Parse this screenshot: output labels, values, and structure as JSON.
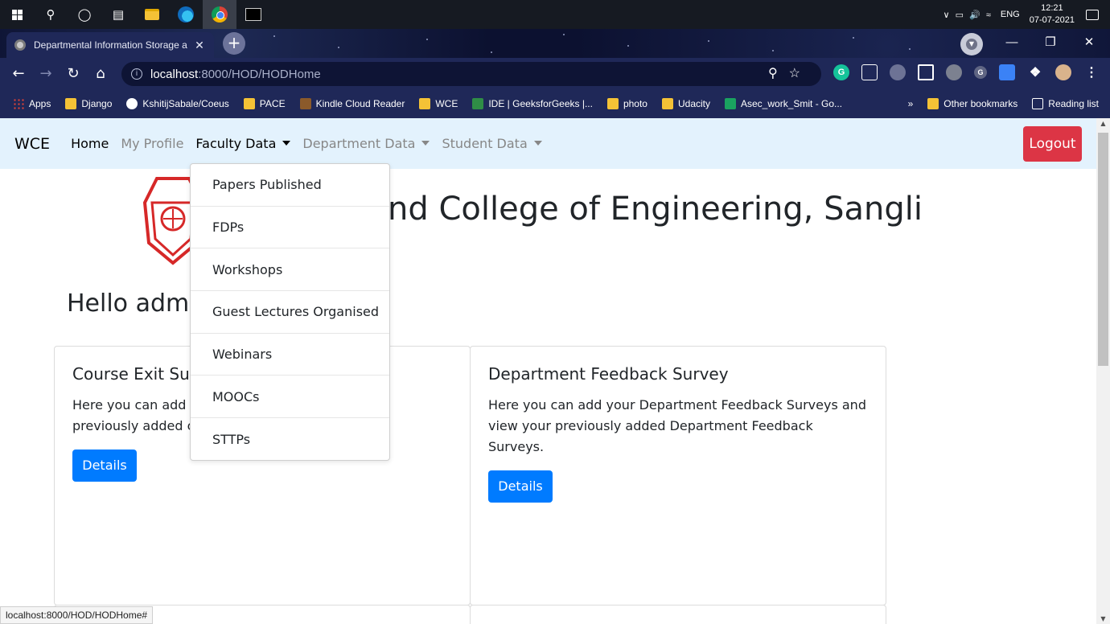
{
  "taskbar": {
    "icons": [
      "windows-icon",
      "search-icon",
      "cortana-icon",
      "task-view-icon",
      "file-explorer-icon",
      "edge-icon",
      "chrome-icon",
      "terminal-icon"
    ],
    "language": "ENG",
    "time": "12:21",
    "date": "07-07-2021"
  },
  "browser": {
    "tab_title": "Departmental Information Storage a",
    "url_host": "localhost",
    "url_path": ":8000/HOD/HODHome",
    "bookmarks": [
      {
        "label": "Apps",
        "icon": "apps"
      },
      {
        "label": "Django",
        "icon": "folder"
      },
      {
        "label": "KshitijSabale/Coeus",
        "icon": "github"
      },
      {
        "label": "PACE",
        "icon": "folder"
      },
      {
        "label": "Kindle Cloud Reader",
        "icon": "kindle"
      },
      {
        "label": "WCE",
        "icon": "folder"
      },
      {
        "label": "IDE | GeeksforGeeks |...",
        "icon": "gfg"
      },
      {
        "label": "photo",
        "icon": "folder"
      },
      {
        "label": "Udacity",
        "icon": "folder"
      },
      {
        "label": "Asec_work_Smit - Go...",
        "icon": "sheets"
      }
    ],
    "bookmarks_overflow": "»",
    "other_bookmarks": "Other bookmarks",
    "reading_list": "Reading list",
    "status_url": "localhost:8000/HOD/HODHome#"
  },
  "navbar": {
    "brand": "WCE",
    "links": [
      "Home",
      "My Profile",
      "Faculty Data",
      "Department Data",
      "Student Data"
    ],
    "logout": "Logout"
  },
  "dropdown": {
    "items": [
      "Papers Published",
      "FDPs",
      "Workshops",
      "Guest Lectures Organised",
      "Webinars",
      "MOOCs",
      "STTPs"
    ]
  },
  "page": {
    "college_title": "nd College of Engineering, Sangli",
    "greeting": "Hello admi"
  },
  "cards": [
    {
      "title": "Course Exit Sur",
      "text": "Here you can add y                                       your previously added co",
      "line1": "Here you can add y",
      "line1_tail": "your",
      "line2": "previously added co",
      "button": "Details"
    },
    {
      "title": "Department Feedback Survey",
      "line1": "Here you can add your Department Feedback Surveys and",
      "line2": "view your previously added Department Feedback Surveys.",
      "button": "Details"
    }
  ],
  "colors": {
    "navbar_bg": "#e3f2fd",
    "logout_bg": "#dc3545",
    "primary": "#007bff"
  }
}
